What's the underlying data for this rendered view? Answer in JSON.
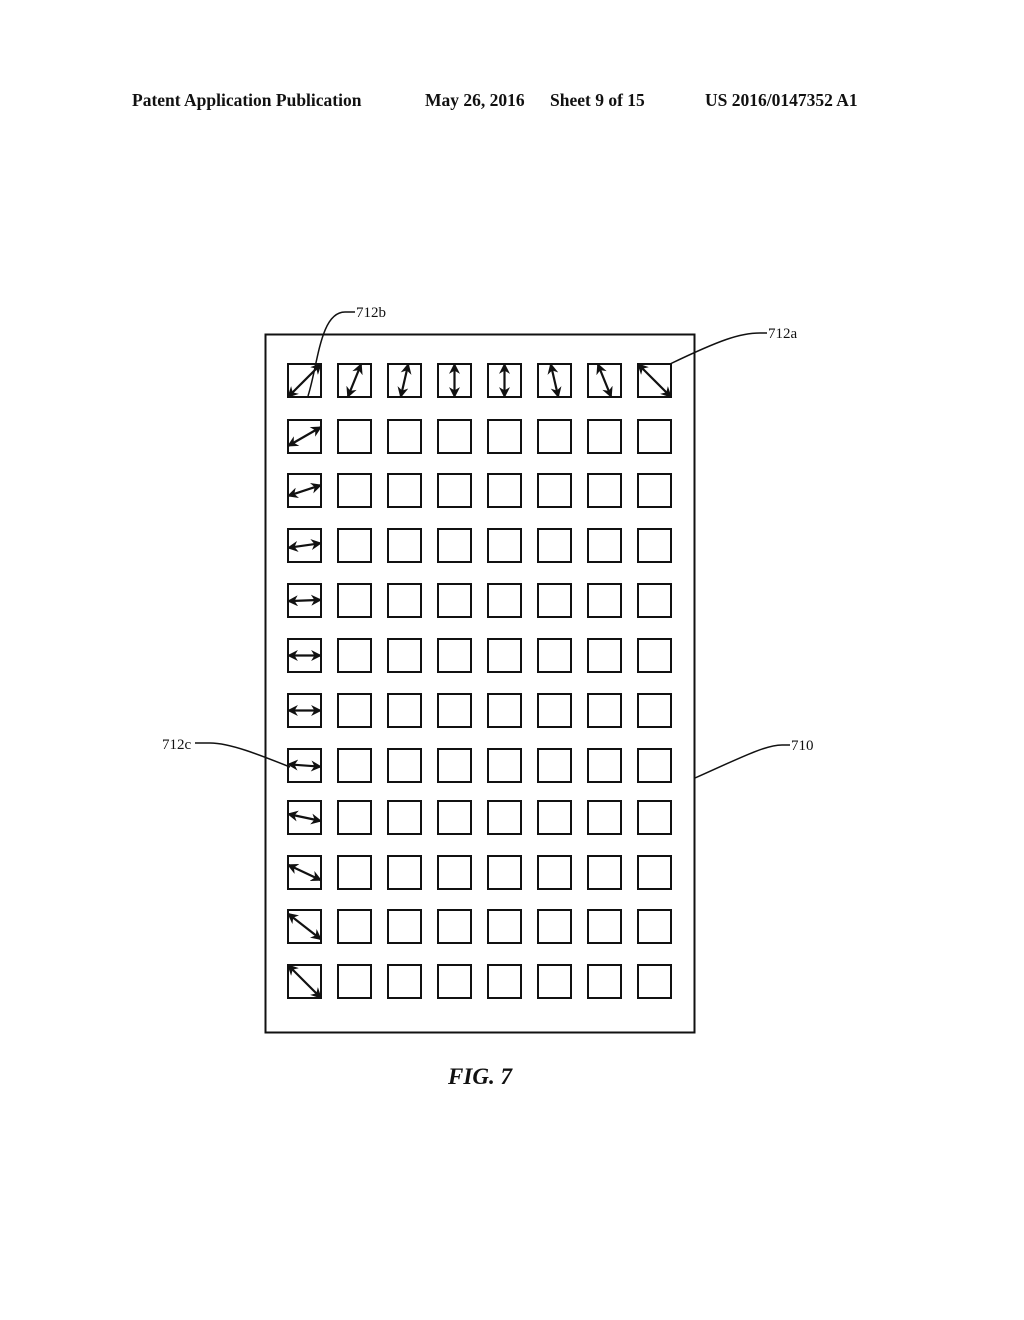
{
  "header": {
    "left": "Patent Application Publication",
    "date": "May 26, 2016",
    "sheet": "Sheet 9 of 15",
    "number": "US 2016/0147352 A1"
  },
  "figure": {
    "caption": "FIG. 7",
    "panel_label": "710",
    "labels": {
      "top_left_element": "712b",
      "top_right_element": "712a",
      "left_column_element": "712c"
    },
    "grid": {
      "rows": 12,
      "cols": 8,
      "top_row_arrow_angles_deg": [
        135,
        112,
        103,
        90,
        90,
        77,
        68,
        45
      ],
      "left_column_arrow_angles_deg": [
        135,
        150,
        162,
        172,
        178,
        180,
        180,
        184,
        192,
        205,
        218,
        225
      ]
    }
  }
}
